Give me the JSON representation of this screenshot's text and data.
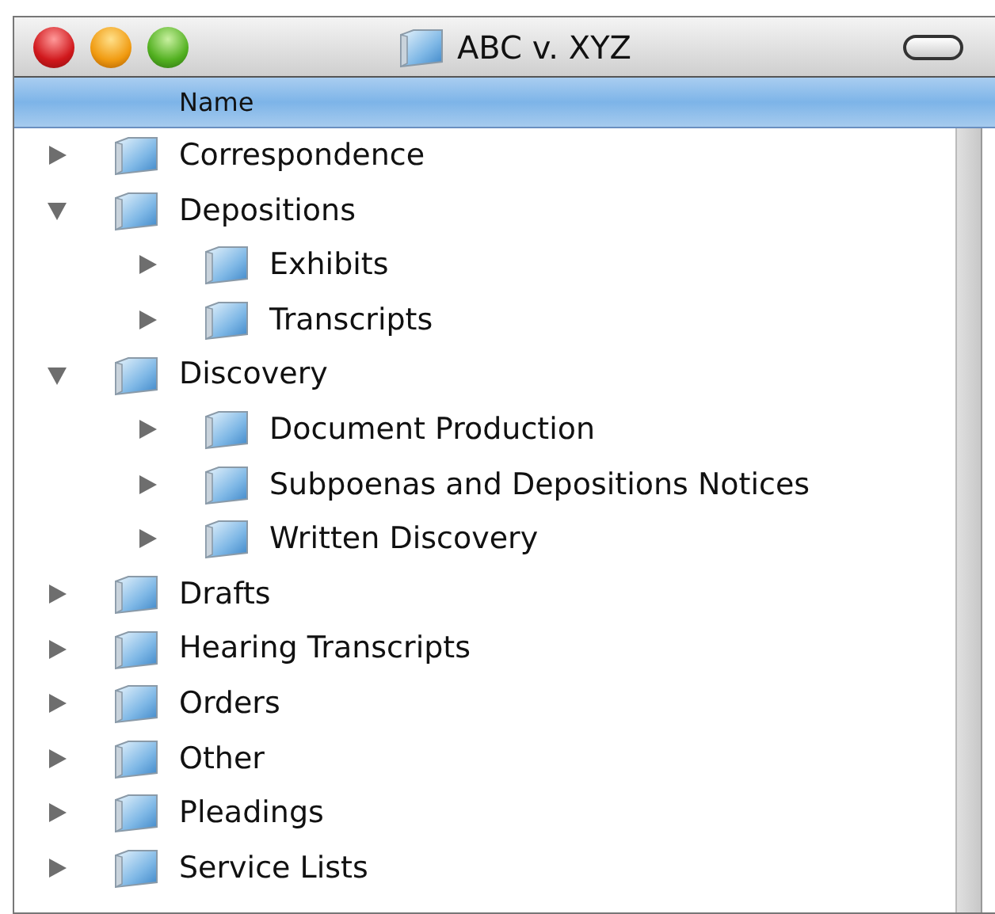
{
  "window": {
    "title": "ABC v. XYZ"
  },
  "columns": [
    {
      "label": "Name"
    }
  ],
  "items": [
    {
      "name": "Correspondence",
      "expanded": false
    },
    {
      "name": "Depositions",
      "expanded": true,
      "children": [
        {
          "name": "Exhibits",
          "expanded": false
        },
        {
          "name": "Transcripts",
          "expanded": false
        }
      ]
    },
    {
      "name": "Discovery",
      "expanded": true,
      "children": [
        {
          "name": "Document Production",
          "expanded": false
        },
        {
          "name": "Subpoenas and Depositions Notices",
          "expanded": false
        },
        {
          "name": "Written Discovery",
          "expanded": false
        }
      ]
    },
    {
      "name": "Drafts",
      "expanded": false
    },
    {
      "name": "Hearing Transcripts",
      "expanded": false
    },
    {
      "name": "Orders",
      "expanded": false
    },
    {
      "name": "Other",
      "expanded": false
    },
    {
      "name": "Pleadings",
      "expanded": false
    },
    {
      "name": "Service Lists",
      "expanded": false
    }
  ]
}
